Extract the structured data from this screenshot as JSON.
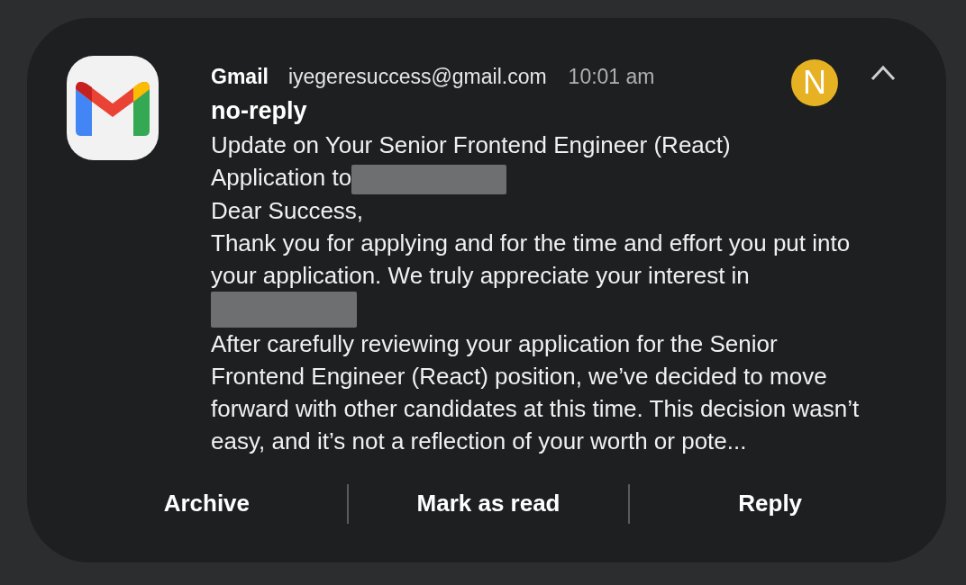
{
  "notification": {
    "app": "Gmail",
    "account": "iyegeresuccess@gmail.com",
    "time": "10:01 am",
    "avatar_letter": "N",
    "sender": "no-reply",
    "body": [
      {
        "kind": "text",
        "text": "Update on Your Senior Frontend Engineer (React)"
      },
      {
        "kind": "text",
        "text": "Application to"
      },
      {
        "kind": "inline_redaction"
      },
      {
        "kind": "text",
        "text": "Dear Success,"
      },
      {
        "kind": "text",
        "text": "Thank you for applying and for the time and effort you put into your application. We truly appreciate your interest in"
      },
      {
        "kind": "block_redaction"
      },
      {
        "kind": "text",
        "text": "After carefully reviewing your application for the Senior Frontend Engineer (React) position, we’ve decided to move forward with other candidates at this time. This decision wasn’t easy, and it’s not a reflection of your worth or pote..."
      }
    ],
    "actions": [
      "Archive",
      "Mark as read",
      "Reply"
    ]
  }
}
